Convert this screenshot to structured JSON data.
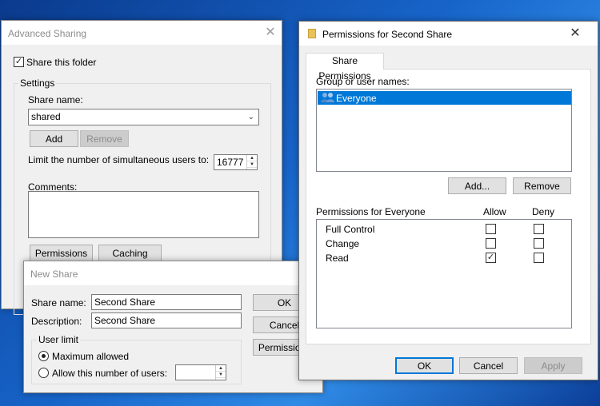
{
  "advanced_sharing": {
    "title": "Advanced Sharing",
    "share_this_folder": "Share this folder",
    "settings_label": "Settings",
    "share_name_label": "Share name:",
    "share_name_value": "shared",
    "add": "Add",
    "remove": "Remove",
    "limit_label": "Limit the number of simultaneous users to:",
    "limit_value": "16777",
    "comments_label": "Comments:",
    "permissions": "Permissions",
    "caching": "Caching"
  },
  "new_share": {
    "title": "New Share",
    "share_name_label": "Share name:",
    "share_name_value": "Second Share",
    "description_label": "Description:",
    "description_value": "Second Share",
    "user_limit_label": "User limit",
    "max_allowed": "Maximum allowed",
    "allow_number": "Allow this number of users:",
    "ok": "OK",
    "cancel": "Cancel",
    "permissions": "Permissions"
  },
  "permissions_window": {
    "title": "Permissions for Second Share",
    "tab": "Share Permissions",
    "group_label": "Group or user names:",
    "users": [
      "Everyone"
    ],
    "add": "Add...",
    "remove": "Remove",
    "perm_header": "Permissions for Everyone",
    "allow_header": "Allow",
    "deny_header": "Deny",
    "rows": [
      {
        "name": "Full Control",
        "allow": false,
        "deny": false
      },
      {
        "name": "Change",
        "allow": false,
        "deny": false
      },
      {
        "name": "Read",
        "allow": true,
        "deny": false
      }
    ],
    "ok": "OK",
    "cancel": "Cancel",
    "apply": "Apply"
  },
  "colors": {
    "selection": "#0078d7",
    "accent_border": "#0078d7",
    "dialog_bg": "#f0f0f0",
    "folder": "#e8c35a"
  }
}
